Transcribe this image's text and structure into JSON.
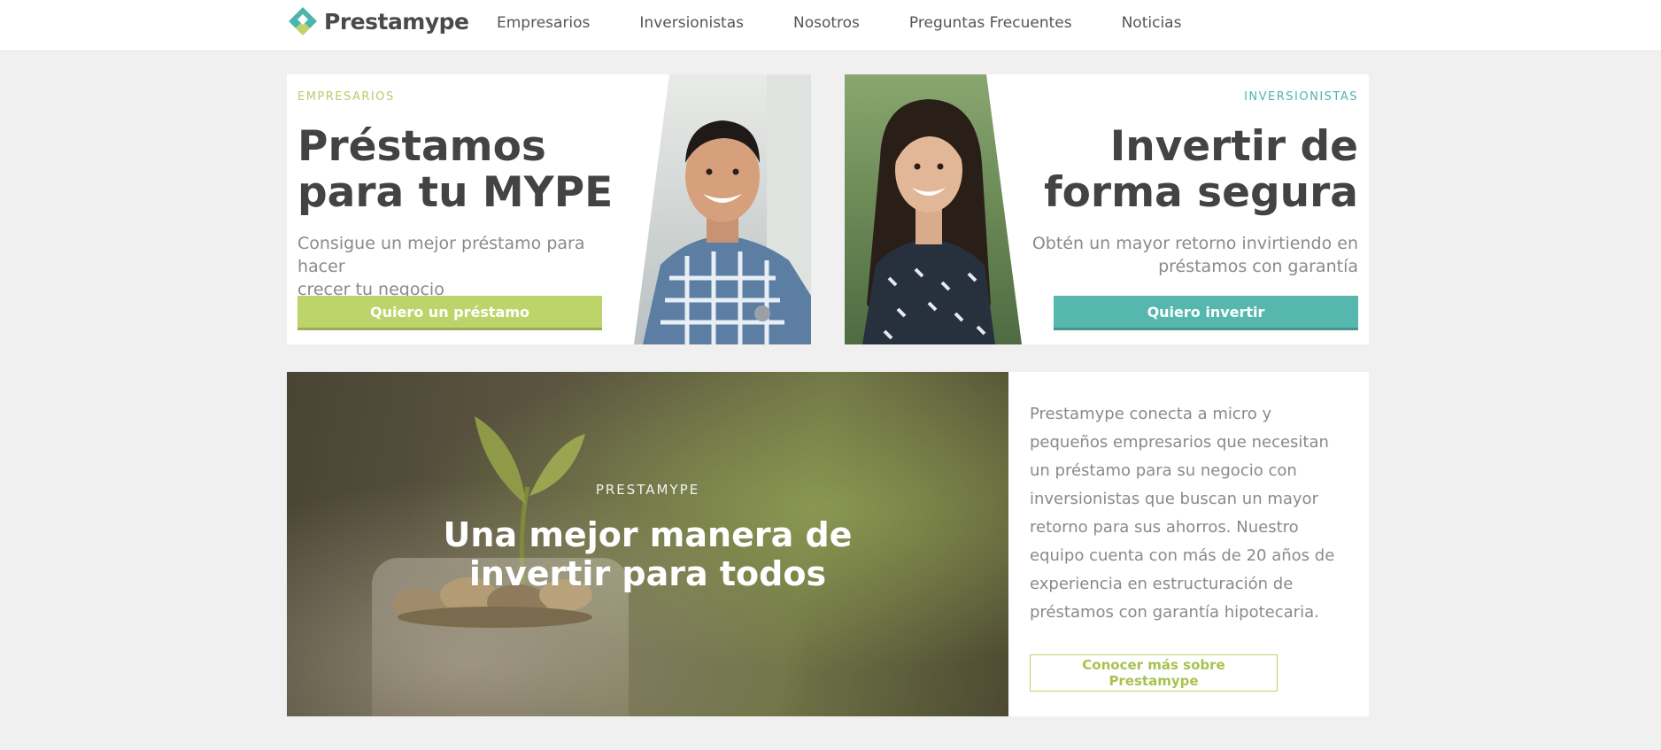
{
  "header": {
    "brand_name": "Prestamype",
    "nav": [
      "Empresarios",
      "Inversionistas",
      "Nosotros",
      "Preguntas Frecuentes",
      "Noticias"
    ]
  },
  "cards": {
    "left": {
      "eyebrow": "EMPRESARIOS",
      "title_line1": "Préstamos",
      "title_line2": "para tu MYPE",
      "subtitle_line1": "Consigue un mejor préstamo para hacer",
      "subtitle_line2": "crecer tu negocio",
      "button": "Quiero un préstamo"
    },
    "right": {
      "eyebrow": "INVERSIONISTAS",
      "title_line1": "Invertir de",
      "title_line2": "forma segura",
      "subtitle_line1": "Obtén un mayor retorno invirtiendo en",
      "subtitle_line2": "préstamos con garantía",
      "button": "Quiero invertir"
    }
  },
  "banner": {
    "eyebrow": "PRESTAMYPE",
    "title_line1": "Una mejor manera de",
    "title_line2": "invertir para todos"
  },
  "about": {
    "text": "Prestamype conecta a micro y pequeños empresarios que necesitan un préstamo para su negocio con inversionistas que buscan un mayor retorno para sus ahorros. Nuestro equipo cuenta con más de 20 años de experiencia en estructuración de préstamos con garantía hipotecaria.",
    "button": "Conocer más sobre Prestamype"
  },
  "colors": {
    "green_accent": "#bcd46a",
    "teal_accent": "#55b7ad",
    "heading": "#434343",
    "body_text": "#8a8a8a",
    "page_bg": "#f0f0f0"
  },
  "icons": [
    "prestamype-logo-icon"
  ]
}
